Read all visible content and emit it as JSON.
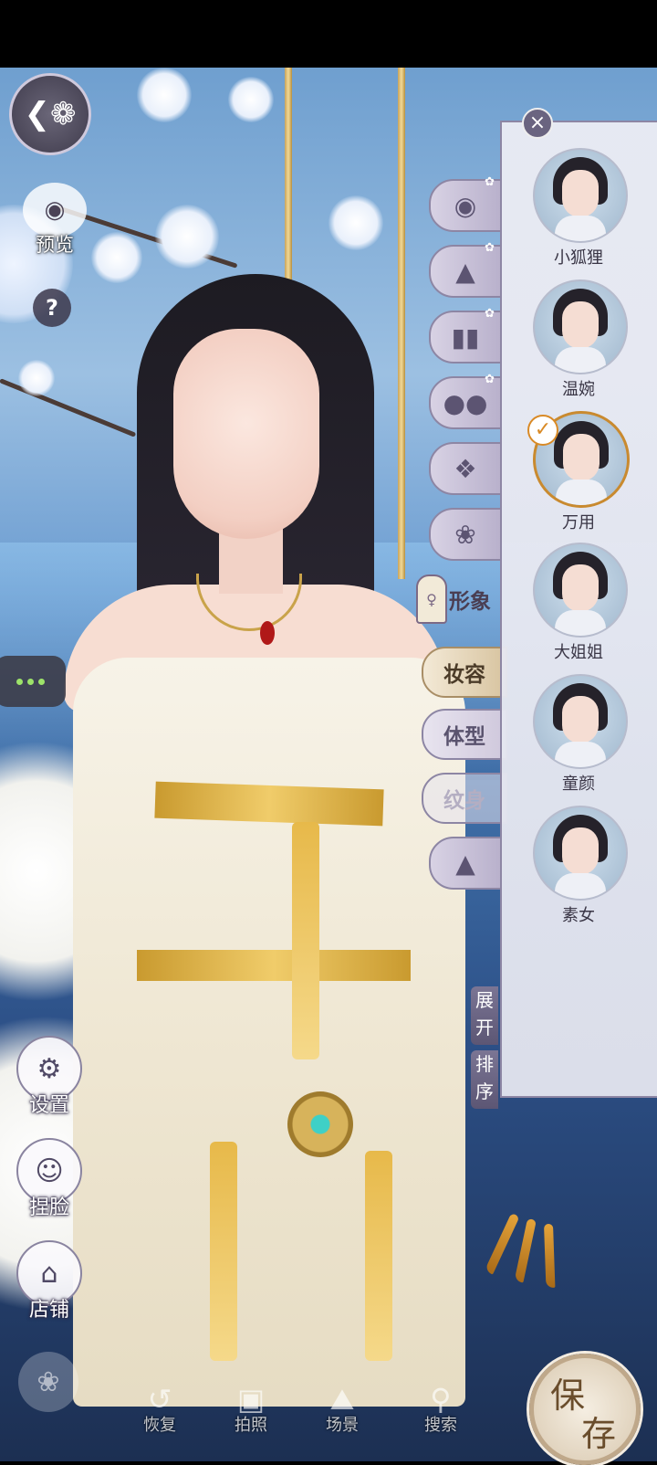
{
  "left": {
    "preview_label": "预览",
    "help_label": "?",
    "settings_label": "设置",
    "face_label": "捏脸",
    "shop_label": "店铺"
  },
  "categories": {
    "xingxiang": "形象",
    "makeup": "妆容",
    "body": "体型",
    "tattoo": "纹身"
  },
  "panel": {
    "presets": [
      {
        "name": "小狐狸",
        "selected": false
      },
      {
        "name": "温婉",
        "selected": false
      },
      {
        "name": "万用",
        "selected": true
      },
      {
        "name": "大姐姐",
        "selected": false
      },
      {
        "name": "童颜",
        "selected": false
      },
      {
        "name": "素女",
        "selected": false
      }
    ],
    "expand_label": "展开",
    "sort_label": "排序"
  },
  "toolbar": {
    "restore_label": "恢复",
    "photo_label": "拍照",
    "scene_label": "场景",
    "search_label": "搜索",
    "save_char1": "保",
    "save_char2": "存"
  }
}
